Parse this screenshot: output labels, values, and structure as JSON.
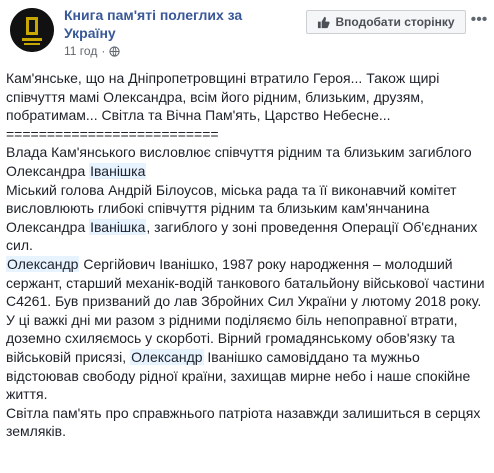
{
  "page": {
    "name": "Книга пам'яті полеглих за Україну",
    "time": "11 год",
    "like_button_label": "Вподобати сторінку",
    "more_icon": "more-icon"
  },
  "post": {
    "p1": "Кам'янське, що на Дніпропетровщині втратило Героя... Також щирі співчуття мамі Олександра, всім його рідним, близьким, друзям, побратимам... Світла та Вічна Пам'ять, Царство Небесне...",
    "separator": "==========================",
    "p2_a": "Влада Кам'янського висловлює співчуття рідним та близьким загиблого Олександра ",
    "p2_tag": "Іванішка",
    "p3_a": "Міський голова Андрій Білоусов, міська рада та її виконавчий комітет висловлюють глибокі співчуття рідним та близьким кам'янчанина Олександра ",
    "p3_tag": "Іванішка",
    "p3_b": ", загиблого у зоні проведення Операції Об'єднаних сил.",
    "p4_tag": "Олександр",
    "p4_b": " Сергійович Іванішко, 1987 року народження – молодший сержант, старший механік-водій танкового батальйону військової частини С4261. Був призваний до лав Збройних Сил України у лютому 2018 року.",
    "p5_a": "У ці важкі дні ми разом з рідними поділяємо біль непоправної втрати, доземно схиляємось у скорботі. Вірний громадянському обов'язку та військовій присязі, ",
    "p5_tag": "Олександр",
    "p5_b": " Іванішко самовіддано та мужньо відстоював свободу рідної країни, захищав мирне небо і наше спокійне життя.",
    "p6": "Світла пам'ять про справжнього патріота назавжди залишиться в серцях земляків."
  },
  "colors": {
    "link": "#385898",
    "tag_bg": "#e7f3ff"
  }
}
